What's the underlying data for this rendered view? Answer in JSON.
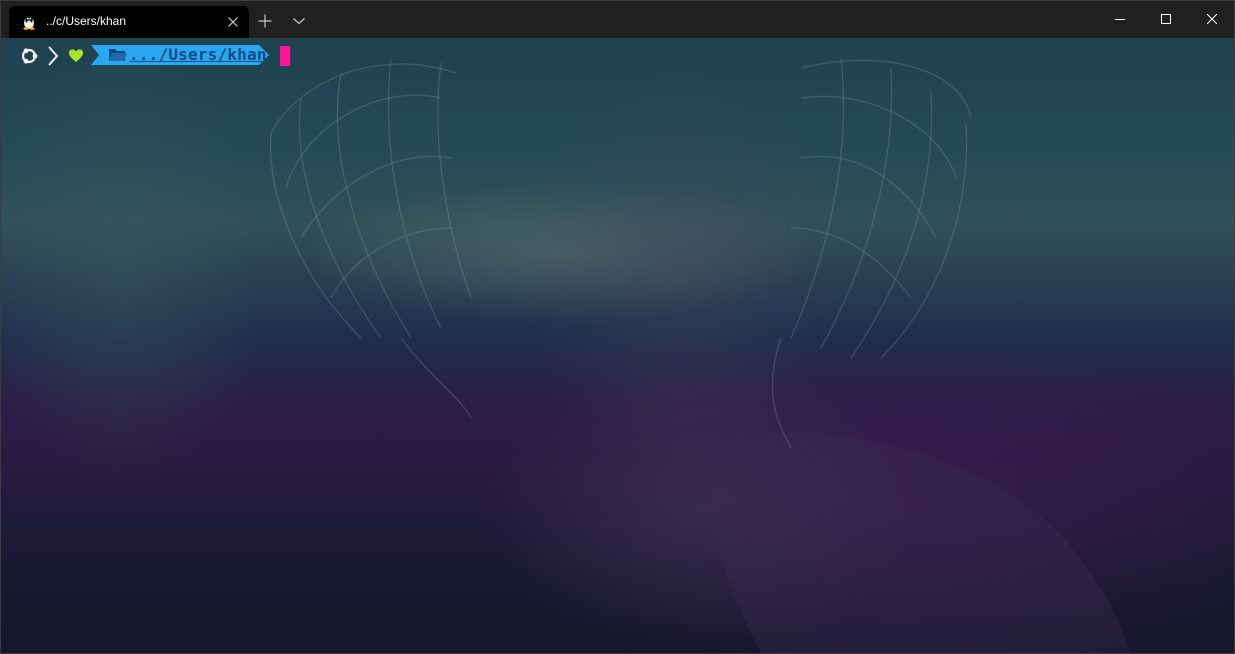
{
  "window": {
    "tab": {
      "title": "../c/Users/khan",
      "icon": "linux-penguin-icon"
    },
    "controls": {
      "new_tab_icon": "plus-icon",
      "dropdown_icon": "chevron-down-icon",
      "minimize_icon": "minimize-icon",
      "maximize_icon": "maximize-icon",
      "close_icon": "close-icon"
    }
  },
  "terminal": {
    "prompt": {
      "os_icon": "ubuntu-icon",
      "separator_icon": "chevron-right-icon",
      "status_icon": "heart-icon",
      "folder_icon": "folder-icon",
      "path": ".../Users/khan"
    },
    "colors": {
      "heart": "#a6e22e",
      "path_segment": "#29a8f0",
      "path_text": "#0f4a86",
      "cursor": "#ff1493"
    }
  }
}
